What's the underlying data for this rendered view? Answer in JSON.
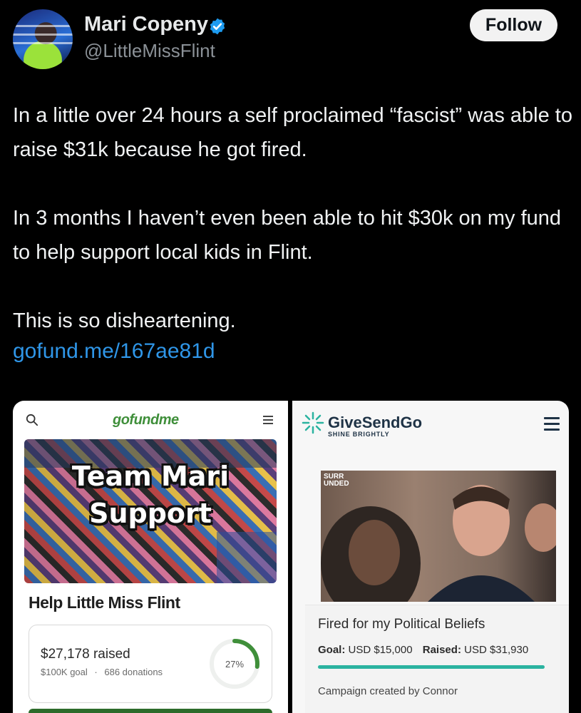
{
  "user": {
    "name": "Mari Copeny",
    "handle": "@LittleMissFlint",
    "verified_color": "#1d9bf0"
  },
  "follow_label": "Follow",
  "tweet": {
    "paragraph1": "In a little over 24 hours a self proclaimed “fascist” was able to raise $31k because he got fired.",
    "paragraph2": "In 3 months I haven’t even been able to hit $30k on my fund to help support local kids in Flint.",
    "paragraph3": "This is so disheartening.",
    "link": "gofund.me/167ae81d"
  },
  "gofundme_card": {
    "logo": "gofundme",
    "photo_text_line1": "Team Mari",
    "photo_text_line2": "Support",
    "title": "Help Little Miss Flint",
    "raised": "$27,178 raised",
    "goal": "$100K goal",
    "separator": "·",
    "donations": "686 donations",
    "progress_label": "27%",
    "progress_fraction": 0.27,
    "accent": "#3f8f3a"
  },
  "givesendgo_card": {
    "logo": "GiveSendGo",
    "tagline": "SHINE BRIGHTLY",
    "photo_badge": "SURR UNDED",
    "title": "Fired for my Political Beliefs",
    "goal_label": "Goal:",
    "goal_value": "USD $15,000",
    "raised_label": "Raised:",
    "raised_value": "USD $31,930",
    "creator": "Campaign created by Connor",
    "accent": "#2bb3a0"
  }
}
